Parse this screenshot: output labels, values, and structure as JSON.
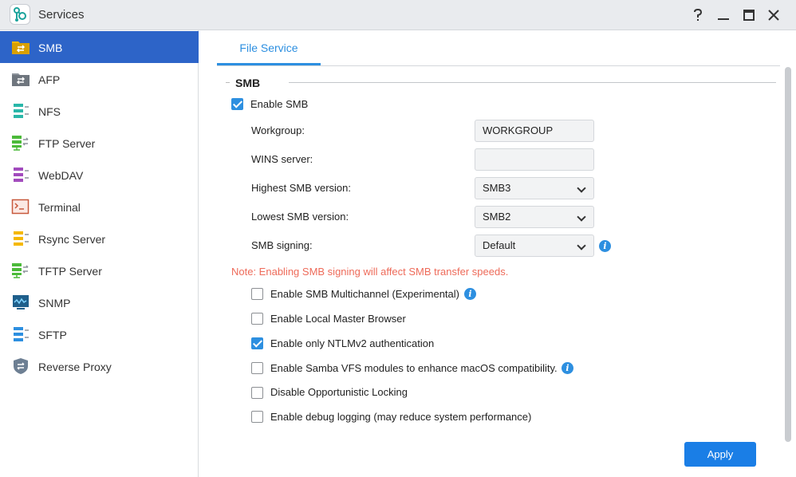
{
  "window": {
    "title": "Services"
  },
  "sidebar": {
    "items": [
      {
        "label": "SMB",
        "icon": "smb-icon",
        "active": true
      },
      {
        "label": "AFP",
        "icon": "afp-icon"
      },
      {
        "label": "NFS",
        "icon": "nfs-icon"
      },
      {
        "label": "FTP Server",
        "icon": "ftp-server-icon"
      },
      {
        "label": "WebDAV",
        "icon": "webdav-icon"
      },
      {
        "label": "Terminal",
        "icon": "terminal-icon"
      },
      {
        "label": "Rsync Server",
        "icon": "rsync-server-icon"
      },
      {
        "label": "TFTP Server",
        "icon": "tftp-server-icon"
      },
      {
        "label": "SNMP",
        "icon": "snmp-icon"
      },
      {
        "label": "SFTP",
        "icon": "sftp-icon"
      },
      {
        "label": "Reverse Proxy",
        "icon": "reverse-proxy-icon"
      }
    ]
  },
  "main": {
    "tab": "File Service",
    "section": "SMB",
    "enable_smb": {
      "label": "Enable SMB",
      "checked": true
    },
    "workgroup": {
      "label": "Workgroup:",
      "value": "WORKGROUP"
    },
    "wins": {
      "label": "WINS server:",
      "value": ""
    },
    "highest": {
      "label": "Highest SMB version:",
      "value": "SMB3"
    },
    "lowest": {
      "label": "Lowest SMB version:",
      "value": "SMB2"
    },
    "signing": {
      "label": "SMB signing:",
      "value": "Default"
    },
    "note": "Note: Enabling SMB signing will affect SMB transfer speeds.",
    "options": [
      {
        "label": "Enable SMB Multichannel (Experimental)",
        "checked": false
      },
      {
        "label": "Enable Local Master Browser",
        "checked": false
      },
      {
        "label": "Enable only NTLMv2 authentication",
        "checked": true
      },
      {
        "label": "Enable Samba VFS modules to enhance macOS compatibility.",
        "checked": false
      },
      {
        "label": "Disable Opportunistic Locking",
        "checked": false
      },
      {
        "label": "Enable debug logging (may reduce system performance)",
        "checked": false
      }
    ],
    "apply": "Apply"
  },
  "colors": {
    "accent": "#2d8fe0",
    "sidebar_active": "#2d64c8",
    "note": "#ee6b5a",
    "apply": "#1a7ee6"
  }
}
